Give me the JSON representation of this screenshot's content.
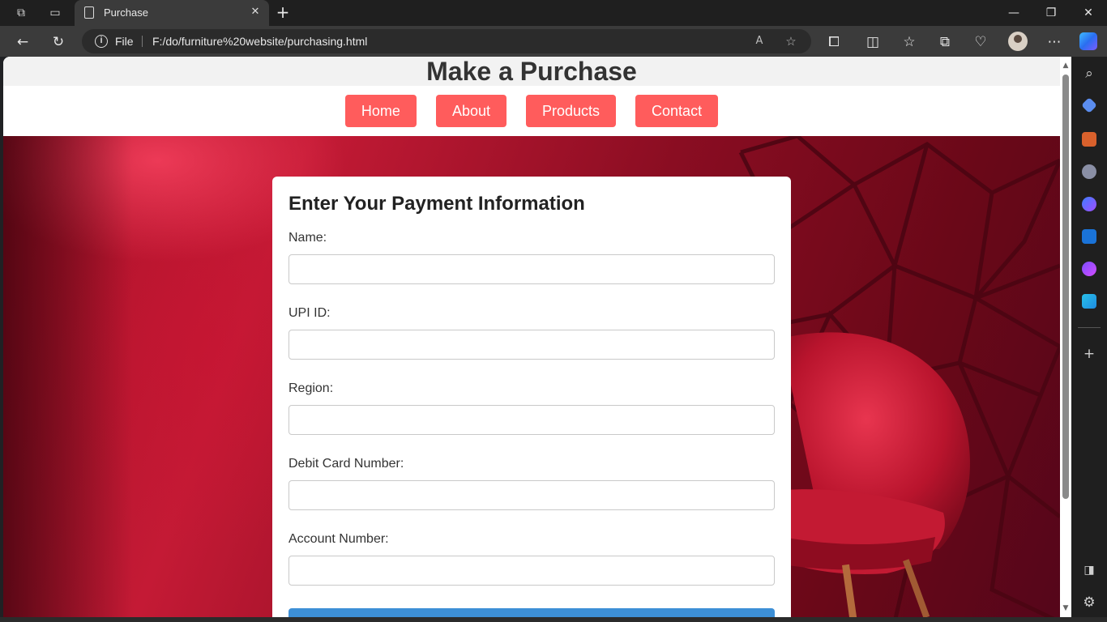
{
  "browser": {
    "tab_title": "Purchase",
    "close_glyph": "✕",
    "new_tab_glyph": "+",
    "omnibox": {
      "scheme_label": "File",
      "url": "F:/do/furniture%20website/purchasing.html"
    },
    "window_controls": {
      "minimize": "—",
      "restore": "❐",
      "close": "✕"
    }
  },
  "page": {
    "header_title": "Make a Purchase",
    "nav": [
      {
        "label": "Home"
      },
      {
        "label": "About"
      },
      {
        "label": "Products"
      },
      {
        "label": "Contact"
      }
    ],
    "form": {
      "title": "Enter Your Payment Information",
      "fields": [
        {
          "label": "Name:",
          "value": ""
        },
        {
          "label": "UPI ID:",
          "value": ""
        },
        {
          "label": "Region:",
          "value": ""
        },
        {
          "label": "Debit Card Number:",
          "value": ""
        },
        {
          "label": "Account Number:",
          "value": ""
        }
      ],
      "submit_label": ""
    }
  },
  "colors": {
    "nav_button": "#ff5c5c",
    "submit_button": "#3d8fd6",
    "hero_red": "#c41a35"
  },
  "icons": {
    "workspaces": "workspaces-icon",
    "tab_actions": "tab-actions-icon",
    "back": "back-arrow-icon",
    "refresh": "refresh-icon",
    "read_aloud": "read-aloud-icon",
    "favorite": "star-icon",
    "extensions": "puzzle-icon",
    "split_screen": "split-screen-icon",
    "favorites": "favorites-icon",
    "collections": "collections-icon",
    "performance": "heart-pulse-icon",
    "more": "more-dots-icon",
    "copilot": "copilot-icon"
  }
}
